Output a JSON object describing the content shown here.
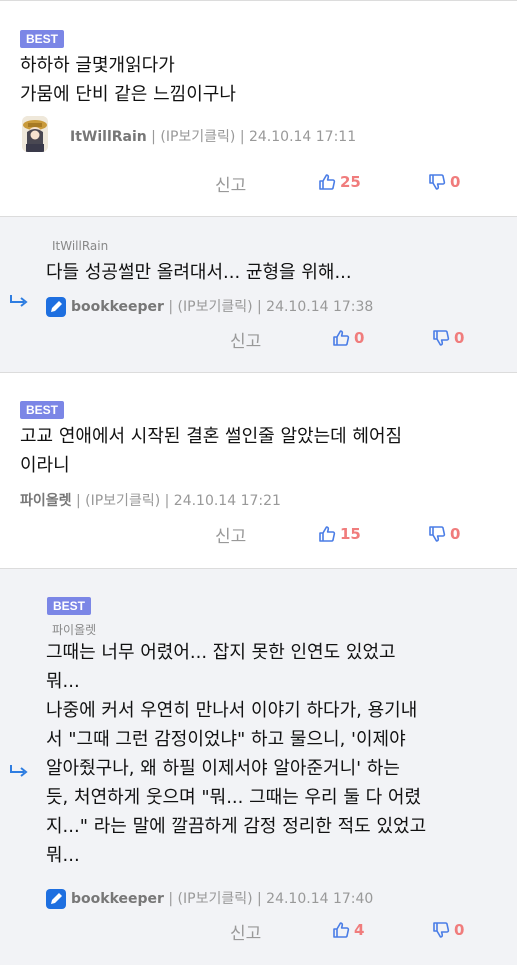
{
  "comments": [
    {
      "badge": "BEST",
      "text": "하하하 글몇개읽다가\n가뭄에 단비 같은 느낌이구나",
      "nickname": "ItWillRain",
      "meta": " | (IP보기클릭) | 24.10.14 17:11",
      "report": "신고",
      "likes": "25",
      "dislikes": "0"
    },
    {
      "parent": "ItWillRain",
      "text": "다들 성공썰만 올려대서... 균형을 위해...",
      "nickname": "bookkeeper",
      "meta": " | (IP보기클릭) | 24.10.14 17:38",
      "report": "신고",
      "likes": "0",
      "dislikes": "0"
    },
    {
      "badge": "BEST",
      "text": "고교 연애에서 시작된 결혼 썰인줄 알았는데 헤어짐\n이라니",
      "nickname": "파이올렛",
      "meta": " | (IP보기클릭) | 24.10.14 17:21",
      "report": "신고",
      "likes": "15",
      "dislikes": "0"
    },
    {
      "badge": "BEST",
      "parent": "파이올렛",
      "text": "그때는 너무 어렸어... 잡지 못한 인연도 있었고\n뭐...\n나중에 커서 우연히 만나서 이야기 하다가, 용기내\n서 \"그때 그런 감정이었냐\" 하고 물으니, '이제야\n알아줬구나, 왜 하필 이제서야 알아준거니' 하는\n듯, 처연하게 웃으며 \"뭐... 그때는 우리 둘 다 어렸\n지...\" 라는 말에 깔끔하게 감정 정리한 적도 있었고\n뭐...",
      "nickname": "bookkeeper",
      "meta": " | (IP보기클릭) | 24.10.14 17:40",
      "report": "신고",
      "likes": "4",
      "dislikes": "0"
    }
  ],
  "icons": {
    "thumb_up": "thumb-up-icon",
    "thumb_down": "thumb-down-icon",
    "reply": "reply-arrow-icon",
    "edit": "pencil-icon"
  },
  "colors": {
    "badge": "#7b86e6",
    "vote_count": "#f07c7c",
    "thumb": "#4a7de6",
    "reply_bg": "#f2f3f6"
  }
}
